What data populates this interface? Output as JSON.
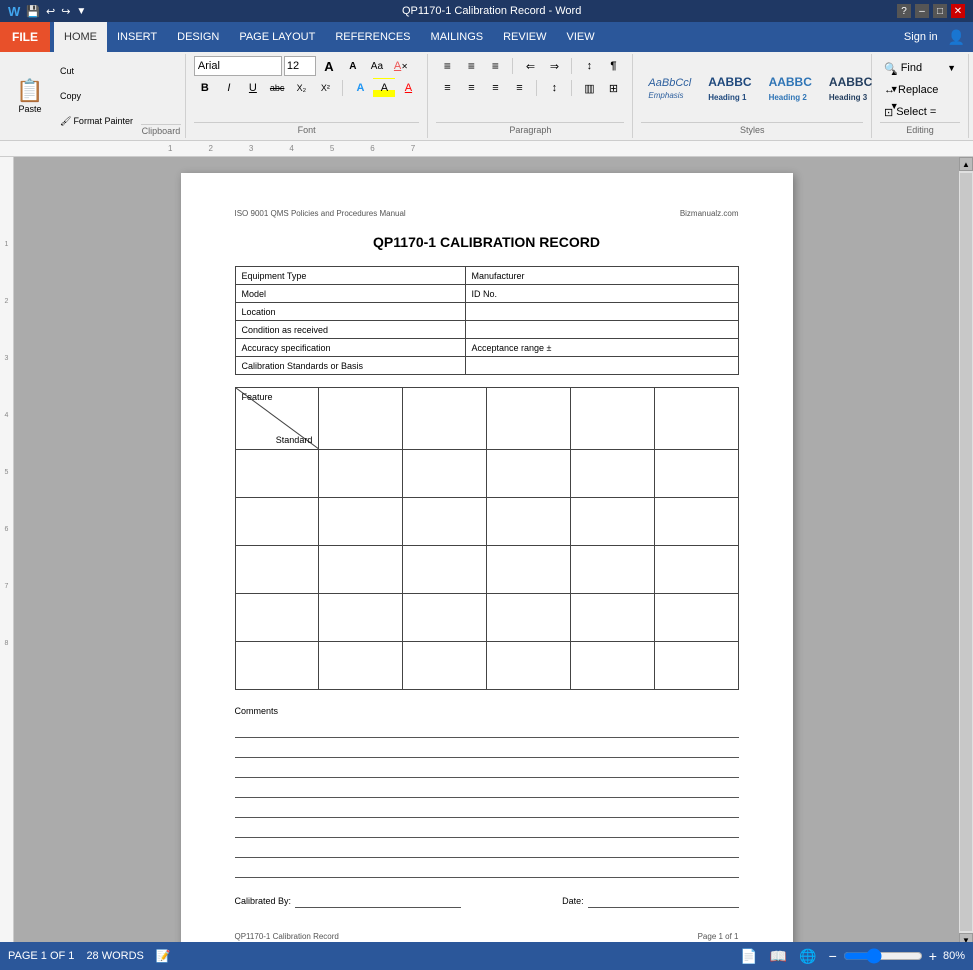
{
  "titleBar": {
    "title": "QP1170-1 Calibration Record - Word",
    "helpBtn": "?",
    "minimizeBtn": "–",
    "restoreBtn": "□",
    "closeBtn": "✕"
  },
  "ribbon": {
    "fileTab": "FILE",
    "tabs": [
      "HOME",
      "INSERT",
      "DESIGN",
      "PAGE LAYOUT",
      "REFERENCES",
      "MAILINGS",
      "REVIEW",
      "VIEW"
    ],
    "activeTab": "HOME",
    "signIn": "Sign in"
  },
  "clipboard": {
    "pasteIcon": "📋",
    "pasteLabel": "Paste",
    "cutLabel": "Cut",
    "copyLabel": "Copy",
    "formatLabel": "Format Painter",
    "groupLabel": "Clipboard"
  },
  "font": {
    "fontName": "Arial",
    "fontSize": "12",
    "groupLabel": "Font",
    "growBtn": "A",
    "shrinkBtn": "A",
    "caseBtn": "Aa",
    "clearBtn": "A",
    "boldBtn": "B",
    "italicBtn": "I",
    "underlineBtn": "U",
    "strikeBtn": "abc",
    "subBtn": "X₂",
    "supBtn": "X²",
    "fontColorBtn": "A",
    "highlightBtn": "A"
  },
  "paragraph": {
    "groupLabel": "Paragraph",
    "bulletsBtn": "≡",
    "numberedBtn": "≡",
    "multiBtn": "≡",
    "decreaseBtn": "⇐",
    "increaseBtn": "⇒",
    "sortBtn": "↕",
    "showHideBtn": "¶",
    "alignLeftBtn": "≡",
    "centerBtn": "≡",
    "alignRightBtn": "≡",
    "justifyBtn": "≡",
    "lineSpacingBtn": "↕",
    "shadingBtn": "□",
    "bordersBtn": "□"
  },
  "styles": {
    "groupLabel": "Styles",
    "items": [
      {
        "label": "AaBbCcl",
        "name": "Emphasis",
        "italic": true
      },
      {
        "label": "AABBC",
        "name": "Heading 1"
      },
      {
        "label": "AABBC",
        "name": "Heading 2"
      },
      {
        "label": "AABBC",
        "name": "Heading 3"
      }
    ],
    "dropdownBtn": "▼"
  },
  "editing": {
    "groupLabel": "Editing",
    "findLabel": "Find",
    "replaceLabel": "Replace",
    "selectLabel": "Select =",
    "dropdownBtn": "▼"
  },
  "document": {
    "headerLeft": "ISO 9001 QMS Policies and Procedures Manual",
    "headerRight": "Bizmanualz.com",
    "title": "QP1170-1 CALIBRATION RECORD",
    "infoTable": [
      {
        "label": "Equipment Type",
        "value": "Manufacturer"
      },
      {
        "label": "Model",
        "value": "ID No."
      },
      {
        "label": "Location",
        "value": ""
      },
      {
        "label": "Condition as received",
        "value": ""
      },
      {
        "label": "Accuracy specification",
        "value": "Acceptance range  ±"
      },
      {
        "label": "Calibration Standards or Basis",
        "value": ""
      }
    ],
    "featureTable": {
      "headerFeature": "Feature",
      "headerStandard": "Standard",
      "rows": 6,
      "cols": 6
    },
    "commentsLabel": "Comments",
    "commentLines": 8,
    "calibratedByLabel": "Calibrated By:",
    "dateLabel": "Date:",
    "footerLeft": "QP1170-1 Calibration Record",
    "footerRight": "Page 1 of 1"
  },
  "statusBar": {
    "pageInfo": "PAGE 1 OF 1",
    "wordCount": "28 WORDS",
    "trackChangesIcon": "📝",
    "zoom": "80%",
    "zoomValue": 80
  }
}
